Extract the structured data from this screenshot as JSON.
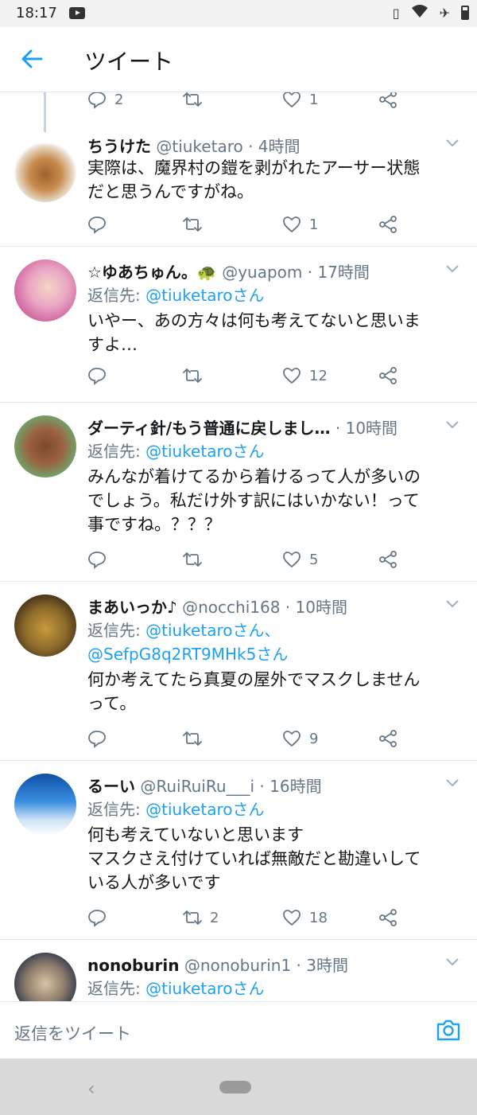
{
  "status_bar": {
    "time": "18:17"
  },
  "header": {
    "title": "ツイート"
  },
  "top_actions": {
    "reply_count": "2",
    "retweet_count": "",
    "like_count": "1"
  },
  "tweets": [
    {
      "name": "ちうけた",
      "meta": "@tiuketaro · 4時間",
      "reply_prefix": "",
      "reply_to": "",
      "reply_to2": "",
      "body": [
        "実際は、魔界村の鎧を剥がれたアーサー状態",
        "だと思うんですがね。"
      ],
      "replies": "",
      "retweets": "",
      "likes": "1"
    },
    {
      "name": "☆ゆあちゅん。🐢",
      "meta": "@yuapom · 17時間",
      "reply_prefix": "返信先: ",
      "reply_to": "@tiuketaroさん",
      "reply_to2": "",
      "body": [
        "いやー、あの方々は何も考えてないと思いま",
        "すよ…"
      ],
      "replies": "",
      "retweets": "",
      "likes": "12"
    },
    {
      "name": "ダーティ針/もう普通に戻しまし…",
      "meta": "· 10時間",
      "reply_prefix": "返信先: ",
      "reply_to": "@tiuketaroさん",
      "reply_to2": "",
      "body": [
        "みんなが着けてるから着けるって人が多いの",
        "でしょう。私だけ外す訳にはいかない！って",
        "事ですね。？？？"
      ],
      "replies": "",
      "retweets": "",
      "likes": "5"
    },
    {
      "name": "まあいっか♪",
      "meta": "@nocchi168 · 10時間",
      "reply_prefix": "返信先: ",
      "reply_to": "@tiuketaroさん、",
      "reply_to2": "@SefpG8q2RT9MHk5さん",
      "body": [
        "何か考えてたら真夏の屋外でマスクしません",
        "って。"
      ],
      "replies": "",
      "retweets": "",
      "likes": "9"
    },
    {
      "name": "るーい",
      "meta": "@RuiRuiRu___i · 16時間",
      "reply_prefix": "返信先: ",
      "reply_to": "@tiuketaroさん",
      "reply_to2": "",
      "body": [
        "何も考えていないと思います",
        "マスクさえ付けていれば無敵だと勘違いして",
        "いる人が多いです"
      ],
      "replies": "",
      "retweets": "2",
      "likes": "18"
    },
    {
      "name": "nonoburin",
      "meta": "@nonoburin1 · 3時間",
      "reply_prefix": "返信先: ",
      "reply_to": "@tiuketaroさん",
      "reply_to2": "",
      "body": [],
      "replies": "",
      "retweets": "",
      "likes": ""
    }
  ],
  "composer": {
    "placeholder": "返信をツイート"
  },
  "colors": {
    "accent": "#1da1f2",
    "secondary_text": "#657786",
    "divider": "#e1e8ed"
  },
  "icons": [
    "back-arrow-icon",
    "youtube-icon",
    "vibrate-icon",
    "wifi-icon",
    "airplane-icon",
    "battery-icon",
    "reply-icon",
    "retweet-icon",
    "like-icon",
    "share-icon",
    "chevron-down-icon",
    "camera-icon"
  ]
}
